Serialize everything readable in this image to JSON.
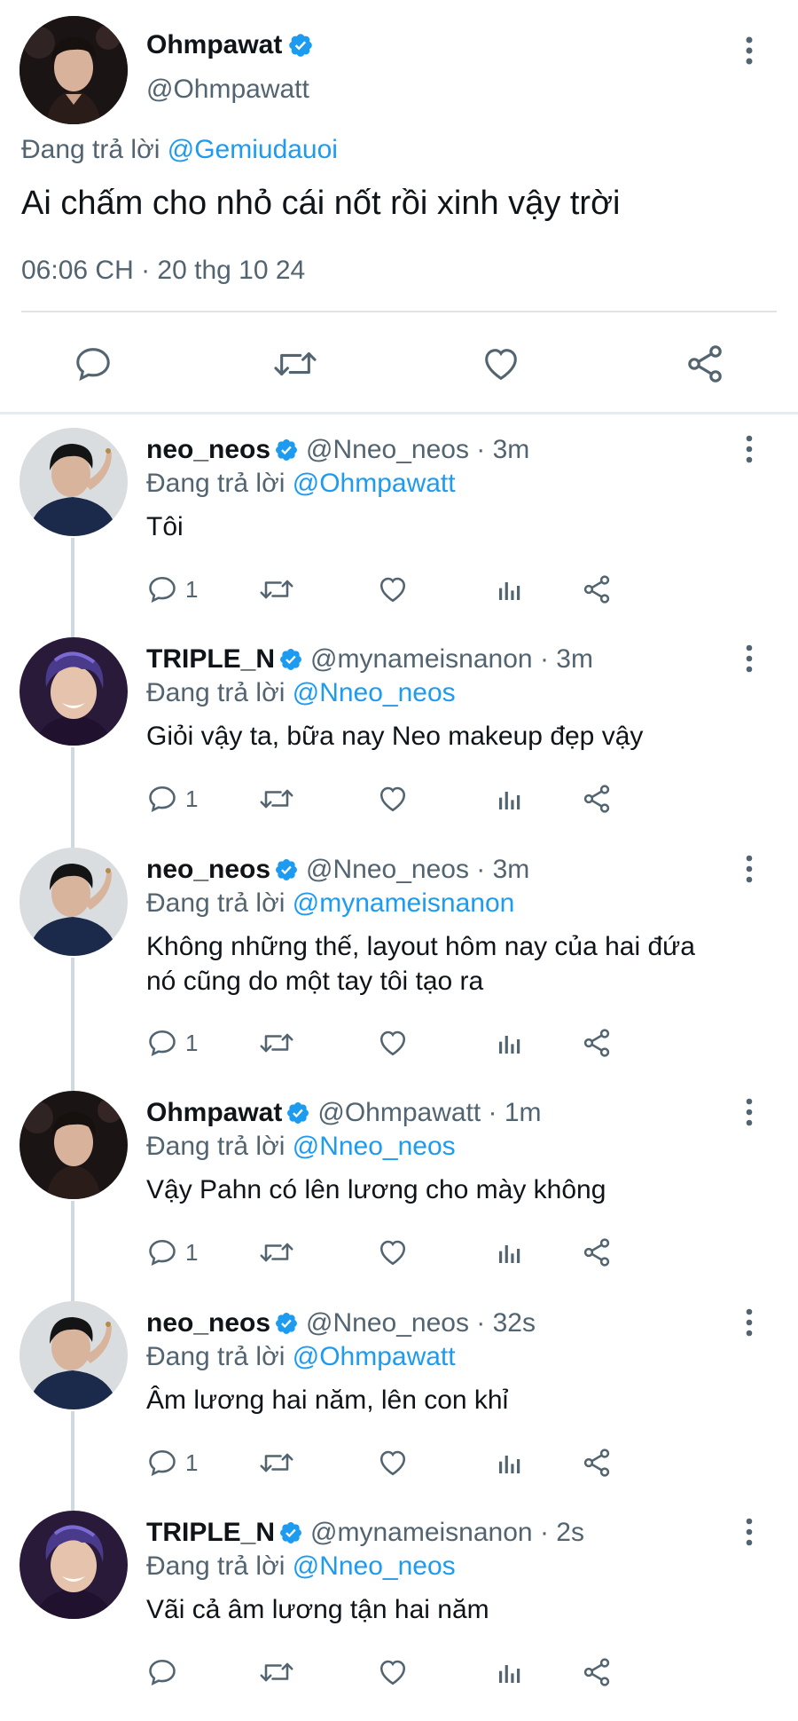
{
  "main_tweet": {
    "name": "Ohmpawat",
    "handle": "@Ohmpawatt",
    "replying_prefix": "Đang trả lời",
    "replying_to": "@Gemiudauoi",
    "text": "Ai chấm cho nhỏ cái nốt rồi xinh vậy trời",
    "timestamp": "06:06 CH · 20 thg 10 24",
    "verified": true
  },
  "replies": [
    {
      "name": "neo_neos",
      "meta": "@Nneo_neos · 3m",
      "replying_prefix": "Đang trả lời",
      "replying_to": "@Ohmpawatt",
      "text_lines": [
        "Tôi"
      ],
      "reply_count": "1",
      "avatar_style": "neo"
    },
    {
      "name": "TRIPLE_N",
      "meta": "@mynameisnanon · 3m",
      "replying_prefix": "Đang trả lời",
      "replying_to": "@Nneo_neos",
      "text_lines": [
        "Giỏi vậy ta, bữa nay Neo makeup đẹp vậy"
      ],
      "reply_count": "1",
      "avatar_style": "nanon"
    },
    {
      "name": "neo_neos",
      "meta": "@Nneo_neos · 3m",
      "replying_prefix": "Đang trả lời",
      "replying_to": "@mynameisnanon",
      "text_lines": [
        "Không những thế, layout hôm nay của hai đứa",
        "nó cũng do một tay tôi tạo ra"
      ],
      "reply_count": "1",
      "avatar_style": "neo"
    },
    {
      "name": "Ohmpawat",
      "meta": "@Ohmpawatt · 1m",
      "replying_prefix": "Đang trả lời",
      "replying_to": "@Nneo_neos",
      "text_lines": [
        "Vậy Pahn có lên lương cho mày không"
      ],
      "reply_count": "1",
      "avatar_style": "ohm"
    },
    {
      "name": "neo_neos",
      "meta": "@Nneo_neos · 32s",
      "replying_prefix": "Đang trả lời",
      "replying_to": "@Ohmpawatt",
      "text_lines": [
        "Âm lương hai năm, lên con khỉ"
      ],
      "reply_count": "1",
      "avatar_style": "neo"
    },
    {
      "name": "TRIPLE_N",
      "meta": "@mynameisnanon · 2s",
      "replying_prefix": "Đang trả lời",
      "replying_to": "@Nneo_neos",
      "text_lines": [
        "Vãi cả âm lương tận hai năm"
      ],
      "reply_count": "",
      "avatar_style": "nanon"
    }
  ],
  "icons": {
    "reply": "comment-bubble-icon",
    "retweet": "retweet-icon",
    "like": "heart-icon",
    "views": "analytics-bars-icon",
    "share": "share-icon",
    "more": "more-vertical-icon",
    "verified": "verified-badge-icon"
  },
  "colors": {
    "accent": "#1d9bf0",
    "secondary_text": "#536471",
    "primary_text": "#0f1419",
    "thread_line": "#cfd9de"
  }
}
